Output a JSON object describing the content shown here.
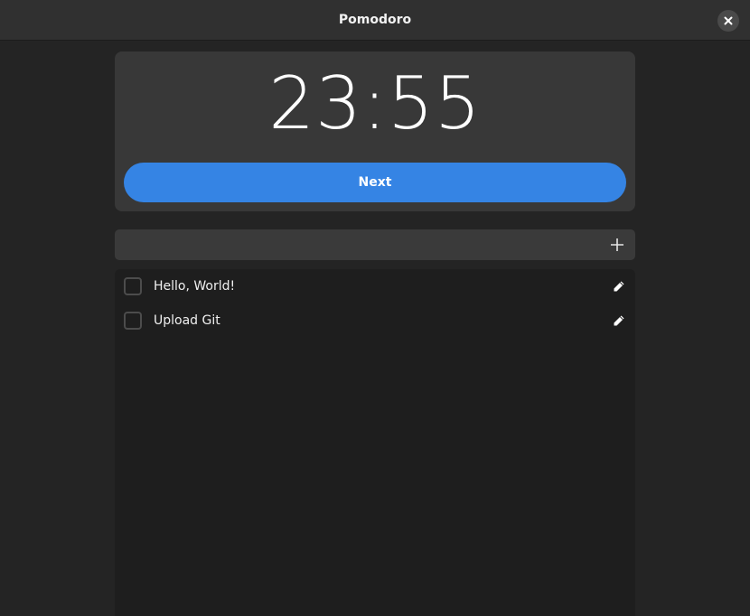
{
  "window": {
    "title": "Pomodoro"
  },
  "timer": {
    "display": "23:55",
    "next_label": "Next"
  },
  "task_entry": {
    "value": "",
    "placeholder": ""
  },
  "tasks": [
    {
      "label": "Hello, World!",
      "done": false
    },
    {
      "label": "Upload Git",
      "done": false
    }
  ],
  "colors": {
    "accent": "#3584e4",
    "window_bg": "#242424",
    "headerbar_bg": "#303030",
    "card_bg": "#383838"
  },
  "icons": {
    "close": "close-icon",
    "add": "plus-icon",
    "edit": "pencil-icon"
  }
}
